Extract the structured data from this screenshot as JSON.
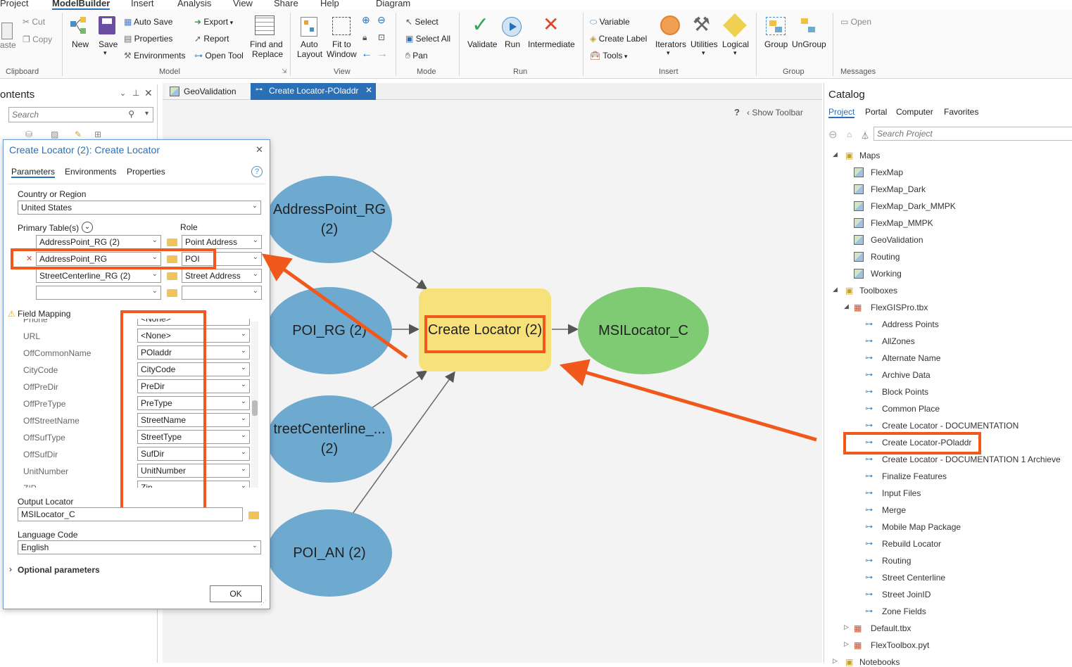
{
  "menubar": {
    "tabs": [
      "Project",
      "ModelBuilder",
      "Insert",
      "Analysis",
      "View",
      "Share",
      "Help",
      "Diagram"
    ],
    "active": "ModelBuilder"
  },
  "ribbon": {
    "clipboard": {
      "cut": "Cut",
      "copy": "Copy",
      "paste": "aste",
      "label": "Clipboard"
    },
    "model": {
      "new": "New",
      "save": "Save",
      "auto_save": "Auto Save",
      "properties": "Properties",
      "environments": "Environments",
      "export": "Export",
      "report": "Report",
      "open_tool": "Open Tool",
      "find_replace_1": "Find and",
      "find_replace_2": "Replace",
      "label": "Model"
    },
    "view": {
      "auto_layout_1": "Auto",
      "auto_layout_2": "Layout",
      "fit_1": "Fit to",
      "fit_2": "Window",
      "label": "View"
    },
    "mode": {
      "select": "Select",
      "select_all": "Select All",
      "pan": "Pan",
      "label": "Mode"
    },
    "run": {
      "validate": "Validate",
      "run": "Run",
      "intermediate": "Intermediate",
      "label": "Run"
    },
    "insert": {
      "variable": "Variable",
      "create_label": "Create Label",
      "tools": "Tools",
      "iterators": "Iterators",
      "utilities": "Utilities",
      "logical": "Logical",
      "label": "Insert"
    },
    "group": {
      "group": "Group",
      "ungroup": "UnGroup",
      "label": "Group"
    },
    "messages": {
      "open": "Open",
      "label": "Messages"
    }
  },
  "contents": {
    "title": "ontents",
    "search_placeholder": "Search"
  },
  "doc_tabs": [
    {
      "label": "GeoValidation"
    },
    {
      "label": "Create Locator-POladdr"
    }
  ],
  "canvas": {
    "show_toolbar": "Show Toolbar",
    "help": "?"
  },
  "nodes": {
    "n1": "AddressPoint_RG (2)",
    "n2": "POI_RG (2)",
    "n3": "treetCenterline_... (2)",
    "n4": "POI_AN (2)",
    "tool": "Create Locator (2)",
    "out": "MSILocator_C"
  },
  "dialog": {
    "title": "Create Locator (2): Create Locator",
    "tabs": [
      "Parameters",
      "Environments",
      "Properties"
    ],
    "country_label": "Country or Region",
    "country_value": "United States",
    "primary_label": "Primary Table(s)",
    "role_label": "Role",
    "rows": [
      {
        "table": "AddressPoint_RG (2)",
        "role": "Point Address"
      },
      {
        "table": "AddressPoint_RG",
        "role": "POI"
      },
      {
        "table": "StreetCenterline_RG (2)",
        "role": "Street Address"
      },
      {
        "table": "",
        "role": ""
      }
    ],
    "field_mapping_label": "Field Mapping",
    "fields": [
      {
        "name": "Phone",
        "value": "<None>"
      },
      {
        "name": "URL",
        "value": "<None>"
      },
      {
        "name": "OffCommonName",
        "value": "POladdr"
      },
      {
        "name": "CityCode",
        "value": "CityCode"
      },
      {
        "name": "OffPreDir",
        "value": "PreDir"
      },
      {
        "name": "OffPreType",
        "value": "PreType"
      },
      {
        "name": "OffStreetName",
        "value": "StreetName"
      },
      {
        "name": "OffSufType",
        "value": "StreetType"
      },
      {
        "name": "OffSufDir",
        "value": "SufDir"
      },
      {
        "name": "UnitNumber",
        "value": "UnitNumber"
      },
      {
        "name": "ZIP",
        "value": "Zip"
      }
    ],
    "output_label": "Output Locator",
    "output_value": "MSILocator_C",
    "language_label": "Language Code",
    "language_value": "English",
    "optional_label": "Optional parameters",
    "ok": "OK"
  },
  "catalog": {
    "title": "Catalog",
    "tabs": [
      "Project",
      "Portal",
      "Computer",
      "Favorites"
    ],
    "search_placeholder": "Search Project",
    "maps_label": "Maps",
    "maps": [
      "FlexMap",
      "FlexMap_Dark",
      "FlexMap_Dark_MMPK",
      "FlexMap_MMPK",
      "GeoValidation",
      "Routing",
      "Working"
    ],
    "toolboxes_label": "Toolboxes",
    "toolbox": "FlexGISPro.tbx",
    "tools": [
      "Address Points",
      "AllZones",
      "Alternate Name",
      "Archive Data",
      "Block Points",
      "Common Place",
      "Create Locator - DOCUMENTATION",
      "Create Locator-POladdr",
      "Create Locator - DOCUMENTATION 1 Archieve",
      "Finalize Features",
      "Input Files",
      "Merge",
      "Mobile Map Package",
      "Rebuild Locator",
      "Routing",
      "Street Centerline",
      "Street JoinID",
      "Zone Fields"
    ],
    "other_toolboxes": [
      "Default.tbx",
      "FlexToolbox.pyt"
    ],
    "notebooks": "Notebooks"
  },
  "colors": {
    "accent": "#2b6fb6",
    "highlight": "#f1581c",
    "node_blue": "#6ea9d0",
    "node_yellow": "#f7e17a",
    "node_green": "#7ecb74"
  }
}
